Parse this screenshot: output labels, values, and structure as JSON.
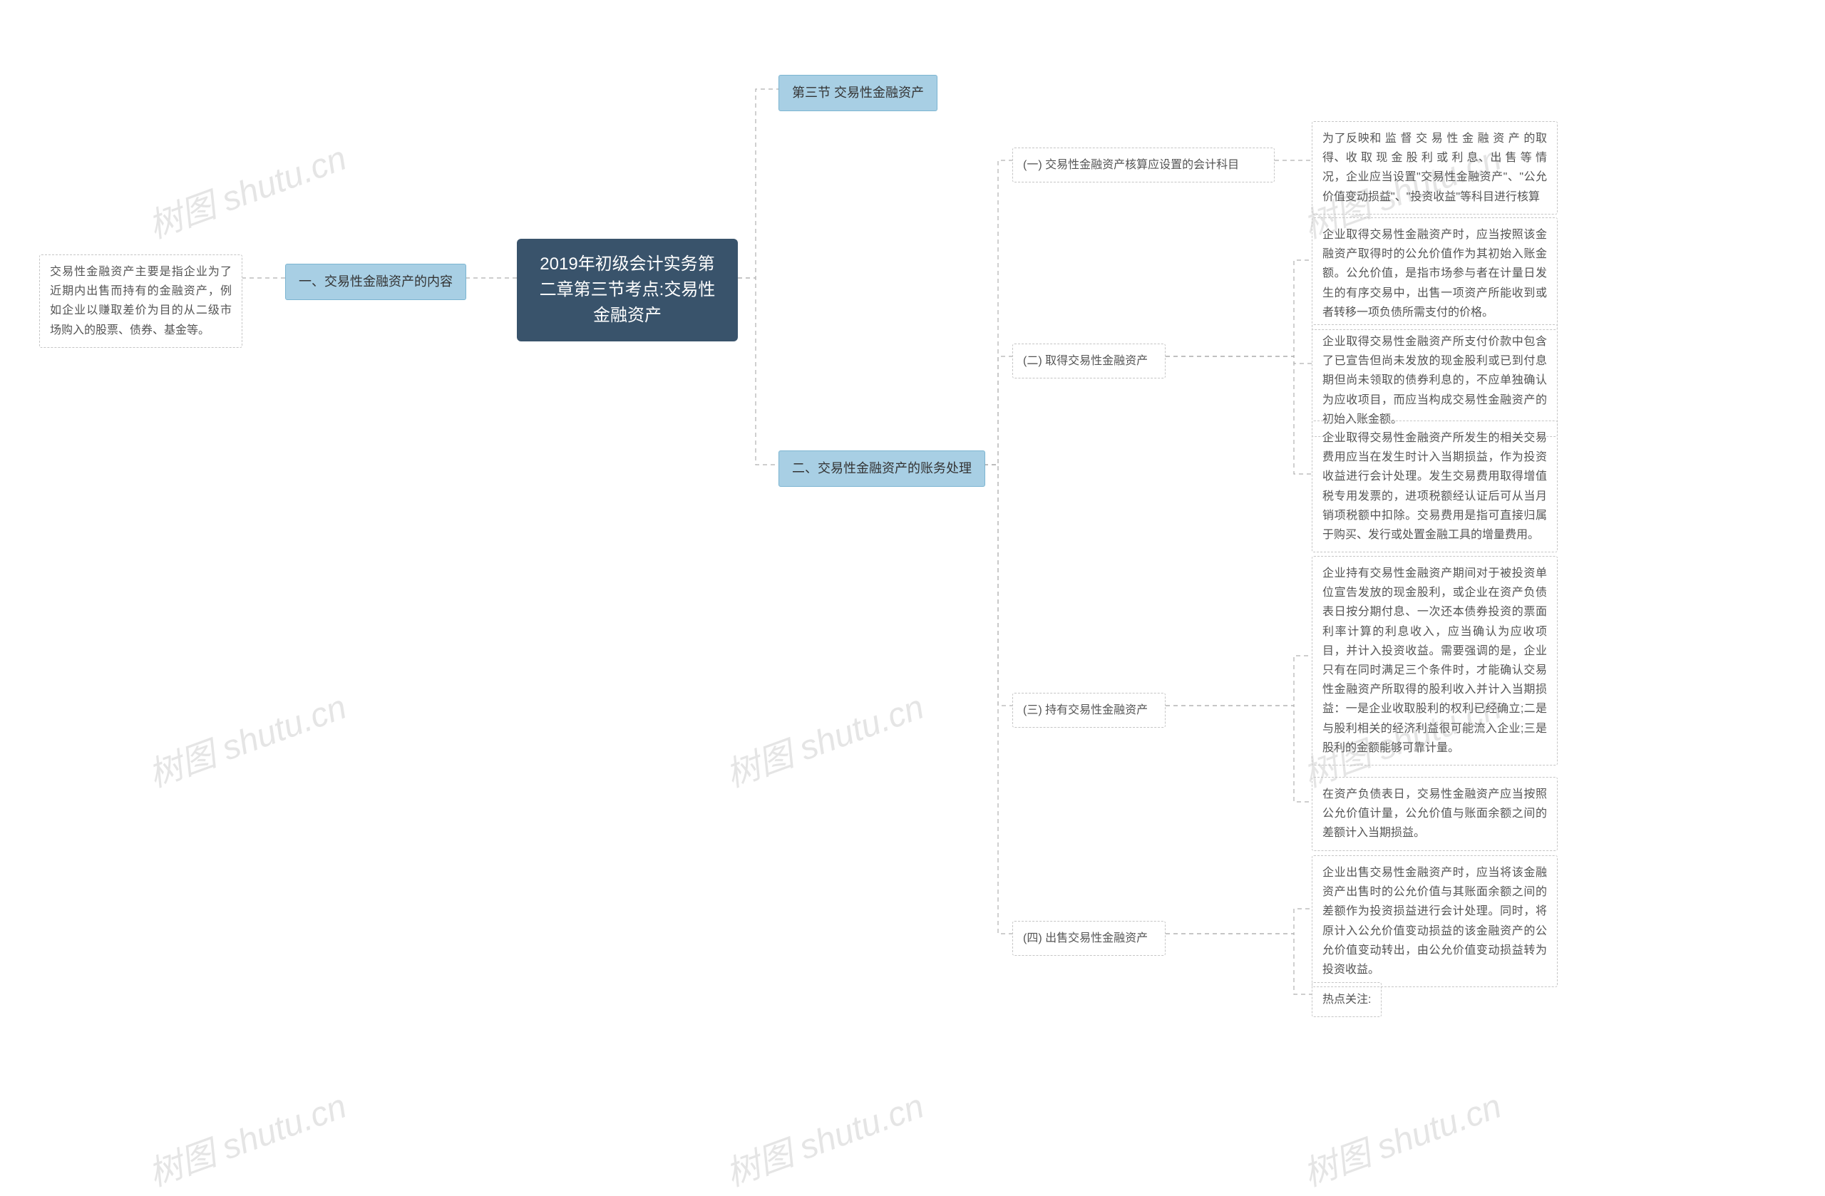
{
  "watermark_text": "树图 shutu.cn",
  "root": {
    "title": "2019年初级会计实务第二章第三节考点:交易性金融资产"
  },
  "left": {
    "branch1": {
      "label": "一、交易性金融资产的内容",
      "leaf": "交易性金融资产主要是指企业为了近期内出售而持有的金融资产，例如企业以赚取差价为目的从二级市场购入的股票、债券、基金等。"
    }
  },
  "right": {
    "branch1": {
      "label": "第三节 交易性金融资产"
    },
    "branch2": {
      "label": "二、交易性金融资产的账务处理",
      "sub1": {
        "label": "(一) 交易性金融资产核算应设置的会计科目",
        "leaf1": "为了反映和 监 督 交 易 性 金 融 资 产 的取得、收 取 现 金 股 利 或 利 息、出 售 等 情况，企业应当设置\"交易性金融资产\"、\"公允价值变动损益\"、\"投资收益\"等科目进行核算"
      },
      "sub2": {
        "label": "(二) 取得交易性金融资产",
        "leaf1": "企业取得交易性金融资产时，应当按照该金融资产取得时的公允价值作为其初始入账金额。公允价值，是指市场参与者在计量日发生的有序交易中，出售一项资产所能收到或者转移一项负债所需支付的价格。",
        "leaf2": "企业取得交易性金融资产所支付价款中包含了已宣告但尚未发放的现金股利或已到付息期但尚未领取的债券利息的，不应单独确认为应收项目，而应当构成交易性金融资产的初始入账金额。",
        "leaf3": "企业取得交易性金融资产所发生的相关交易费用应当在发生时计入当期损益，作为投资收益进行会计处理。发生交易费用取得增值税专用发票的，进项税额经认证后可从当月销项税额中扣除。交易费用是指可直接归属于购买、发行或处置金融工具的增量费用。"
      },
      "sub3": {
        "label": "(三) 持有交易性金融资产",
        "leaf1": "企业持有交易性金融资产期间对于被投资单位宣告发放的现金股利，或企业在资产负债表日按分期付息、一次还本债券投资的票面利率计算的利息收入，应当确认为应收项目，并计入投资收益。需要强调的是，企业只有在同时满足三个条件时，才能确认交易性金融资产所取得的股利收入并计入当期损益：一是企业收取股利的权利已经确立;二是与股利相关的经济利益很可能流入企业;三是股利的金额能够可靠计量。",
        "leaf2": "在资产负债表日，交易性金融资产应当按照公允价值计量，公允价值与账面余额之间的差额计入当期损益。"
      },
      "sub4": {
        "label": "(四) 出售交易性金融资产",
        "leaf1": "企业出售交易性金融资产时，应当将该金融资产出售时的公允价值与其账面余额之间的差额作为投资损益进行会计处理。同时，将原计入公允价值变动损益的该金融资产的公允价值变动转出，由公允价值变动损益转为投资收益。",
        "leaf2": "热点关注:"
      }
    }
  },
  "colors": {
    "root_bg": "#39536b",
    "solid_bg": "#a8cfe4",
    "dashed_border": "#c5c5c5"
  }
}
